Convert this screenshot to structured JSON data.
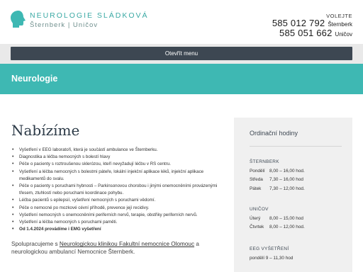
{
  "header": {
    "logo_name": "NEUROLOGIE SLÁDKOVÁ",
    "logo_sub": "Šternberk | Uničov",
    "call_label": "VOLEJTE",
    "phones": [
      {
        "number": "585 012 792",
        "city": "Šternberk"
      },
      {
        "number": "585 051 662",
        "city": "Uničov"
      }
    ]
  },
  "menu": {
    "button_label": "Otevřít menu"
  },
  "banner": {
    "title": "Neurologie"
  },
  "main": {
    "title": "Nabízíme",
    "services": [
      "Vyšetření v EEG laboratoři, která je součástí ambulance ve Šternberku.",
      "Diagnostika a léčba nemocných s bolestí hlavy",
      "Péče o pacienty s roztroušenou sklerózou, kteří nevyžadují léčbu v RS centru.",
      "Vyšetření a léčba nemocných s bolestmi páteře, lokální injekční aplikace léků, injekční aplikace medikamentů do svalu.",
      "Péče o pacienty s poruchami hybnosti – Parkinsonovou chorobou i jinými onemocněními provázenými třesem, ztuhlostí nebo poruchami koordinace pohybu.",
      "Léčba pacientů s epilepsií, vyšetření nemocných s poruchami vědomí.",
      "Péče o nemocné po mozkové cévní příhodě, prevence její recidivy.",
      "Vyšetření nemocných s onemocněními periferních nervů, terapie, obstřiky periferních nervů.",
      "Vyšetření a léčba nemocných s poruchami paměti.",
      "Od 1.4.2024 provádíme i EMG vyšetření"
    ],
    "collab_prefix": "Spolupracujeme s ",
    "collab_link1": "Neurologickou klinikou Fakultní nemocnice Olomouc",
    "collab_mid": " a neurologickou ambulancí Nemocnice Šternberk."
  },
  "sidebar": {
    "title": "Ordinační hodiny",
    "sections": [
      {
        "heading": "ŠTERNBERK",
        "rows": [
          {
            "day": "Pondělí",
            "hours": "8,00 – 16,00 hod."
          },
          {
            "day": "Středa",
            "hours": "7,30 – 16,00 hod"
          },
          {
            "day": "Pátek",
            "hours": "7,30 – 12,00 hod."
          }
        ]
      },
      {
        "heading": "UNIČOV",
        "rows": [
          {
            "day": "Úterý",
            "hours": "8,00 – 15,00 hod"
          },
          {
            "day": "Čtvrtek",
            "hours": "8,00 – 12,00 hod."
          }
        ]
      },
      {
        "heading": "EEG VYŠETŘENÍ",
        "rows": [
          {
            "day": "",
            "hours": "pondělí 9 – 11,30 hod"
          }
        ]
      }
    ]
  },
  "colors": {
    "accent": "#3eb8b3",
    "dark": "#3d4752",
    "logo": "#3aa9a4"
  }
}
